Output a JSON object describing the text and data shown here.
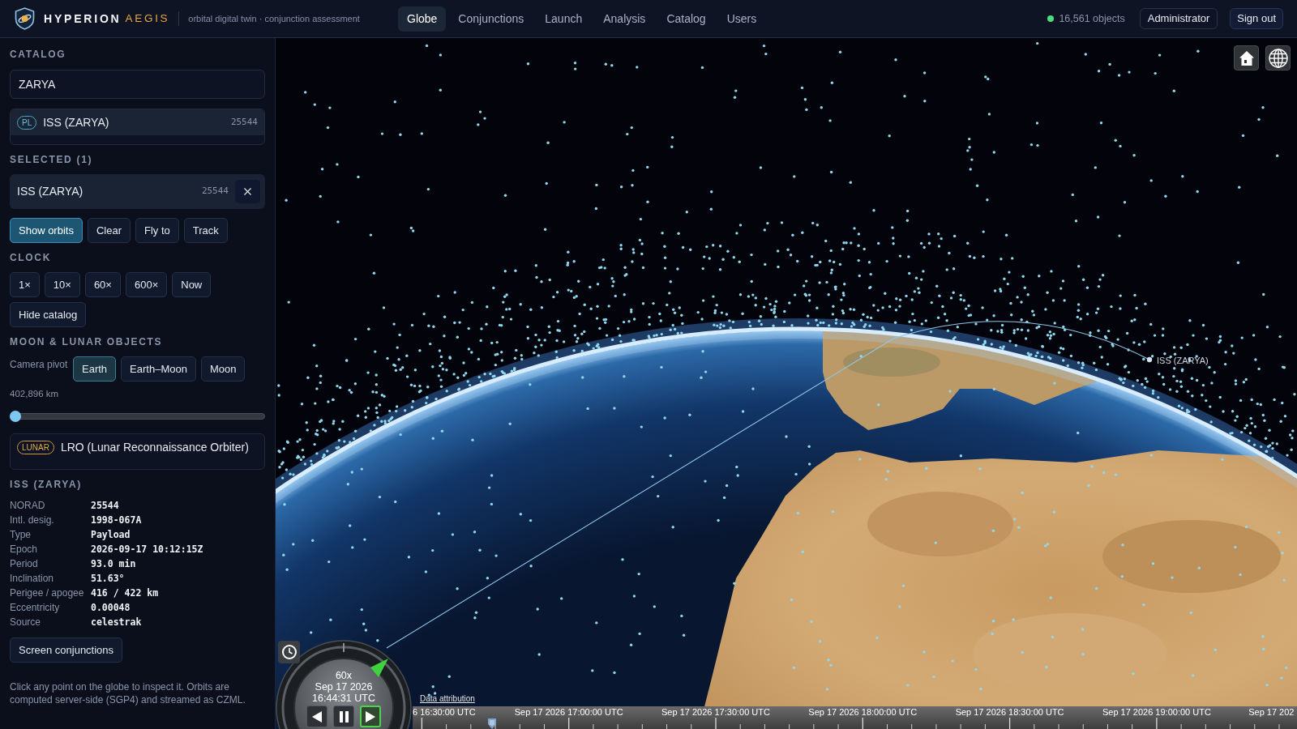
{
  "header": {
    "brand": {
      "primary": "HYPERION",
      "secondary": "AEGIS"
    },
    "subtitle": "orbital digital twin · conjunction assessment",
    "nav": [
      {
        "label": "Globe",
        "selected": true
      },
      {
        "label": "Conjunctions",
        "selected": false
      },
      {
        "label": "Launch",
        "selected": false
      },
      {
        "label": "Analysis",
        "selected": false
      },
      {
        "label": "Catalog",
        "selected": false
      },
      {
        "label": "Users",
        "selected": false
      }
    ],
    "status": {
      "online": true,
      "text": "16,561 objects"
    },
    "user_button": "Administrator",
    "sign_out_button": "Sign out"
  },
  "sidebar": {
    "catalog": {
      "heading": "CATALOG",
      "search": {
        "value": "ZARYA"
      },
      "results": [
        {
          "badge": "PL",
          "name": "ISS (ZARYA)",
          "norad": "25544",
          "selected": true
        }
      ]
    },
    "selected": {
      "heading": "SELECTED (1)",
      "items": [
        {
          "name": "ISS (ZARYA)",
          "norad": "25544"
        }
      ],
      "actions": [
        {
          "label": "Show orbits",
          "active": true
        },
        {
          "label": "Clear",
          "active": false
        },
        {
          "label": "Fly to",
          "active": false
        },
        {
          "label": "Track",
          "active": false
        }
      ]
    },
    "clock": {
      "heading": "CLOCK",
      "speeds": [
        "1×",
        "10×",
        "60×",
        "600×",
        "Now"
      ],
      "catalog_toggle": "Hide catalog"
    },
    "moon": {
      "heading": "MOON & LUNAR OBJECTS",
      "pivot_label": "Camera pivot",
      "pivots": [
        {
          "label": "Earth",
          "selected": true
        },
        {
          "label": "Earth–Moon",
          "selected": false
        },
        {
          "label": "Moon",
          "selected": false
        }
      ],
      "distance": "402,896 km",
      "distance_slider": {
        "level": 0
      },
      "objects": [
        {
          "badge": "LUNAR",
          "name": "LRO (Lunar Reconnaissance Orbiter)"
        }
      ]
    },
    "details": {
      "heading": "ISS (ZARYA)",
      "fields": [
        {
          "label": "NORAD",
          "value": "25544"
        },
        {
          "label": "Intl. desig.",
          "value": "1998-067A"
        },
        {
          "label": "Type",
          "value": "Payload"
        },
        {
          "label": "Epoch",
          "value": "2026-09-17 10:12:15Z"
        },
        {
          "label": "Period",
          "value": "93.0 min"
        },
        {
          "label": "Inclination",
          "value": "51.63°"
        },
        {
          "label": "Perigee / apogee",
          "value": "416 / 422 km"
        },
        {
          "label": "Eccentricity",
          "value": "0.00048"
        },
        {
          "label": "Source",
          "value": "celestrak"
        }
      ],
      "action": "Screen conjunctions"
    },
    "note": "Click any point on the globe to inspect it. Orbits are computed server-side (SGP4) and streamed as CZML."
  },
  "globe": {
    "satellite_label": "ISS (ZARYA)",
    "clock_widget": {
      "speed": "60x",
      "date": "Sep 17 2026",
      "time": "16:44:31 UTC",
      "controls": [
        {
          "kind": "reverse",
          "selected": false
        },
        {
          "kind": "pause",
          "selected": false
        },
        {
          "kind": "play",
          "selected": true
        }
      ]
    },
    "attribution": "Data attribution",
    "timeline": {
      "level": 0.09,
      "labels": [
        "6 16:30:00 UTC",
        "Sep 17 2026 17:00:00 UTC",
        "Sep 17 2026 17:30:00 UTC",
        "Sep 17 2026 18:00:00 UTC",
        "Sep 17 2026 18:30:00 UTC",
        "Sep 17 2026 19:00:00 UTC",
        "Sep 17 202"
      ]
    }
  }
}
